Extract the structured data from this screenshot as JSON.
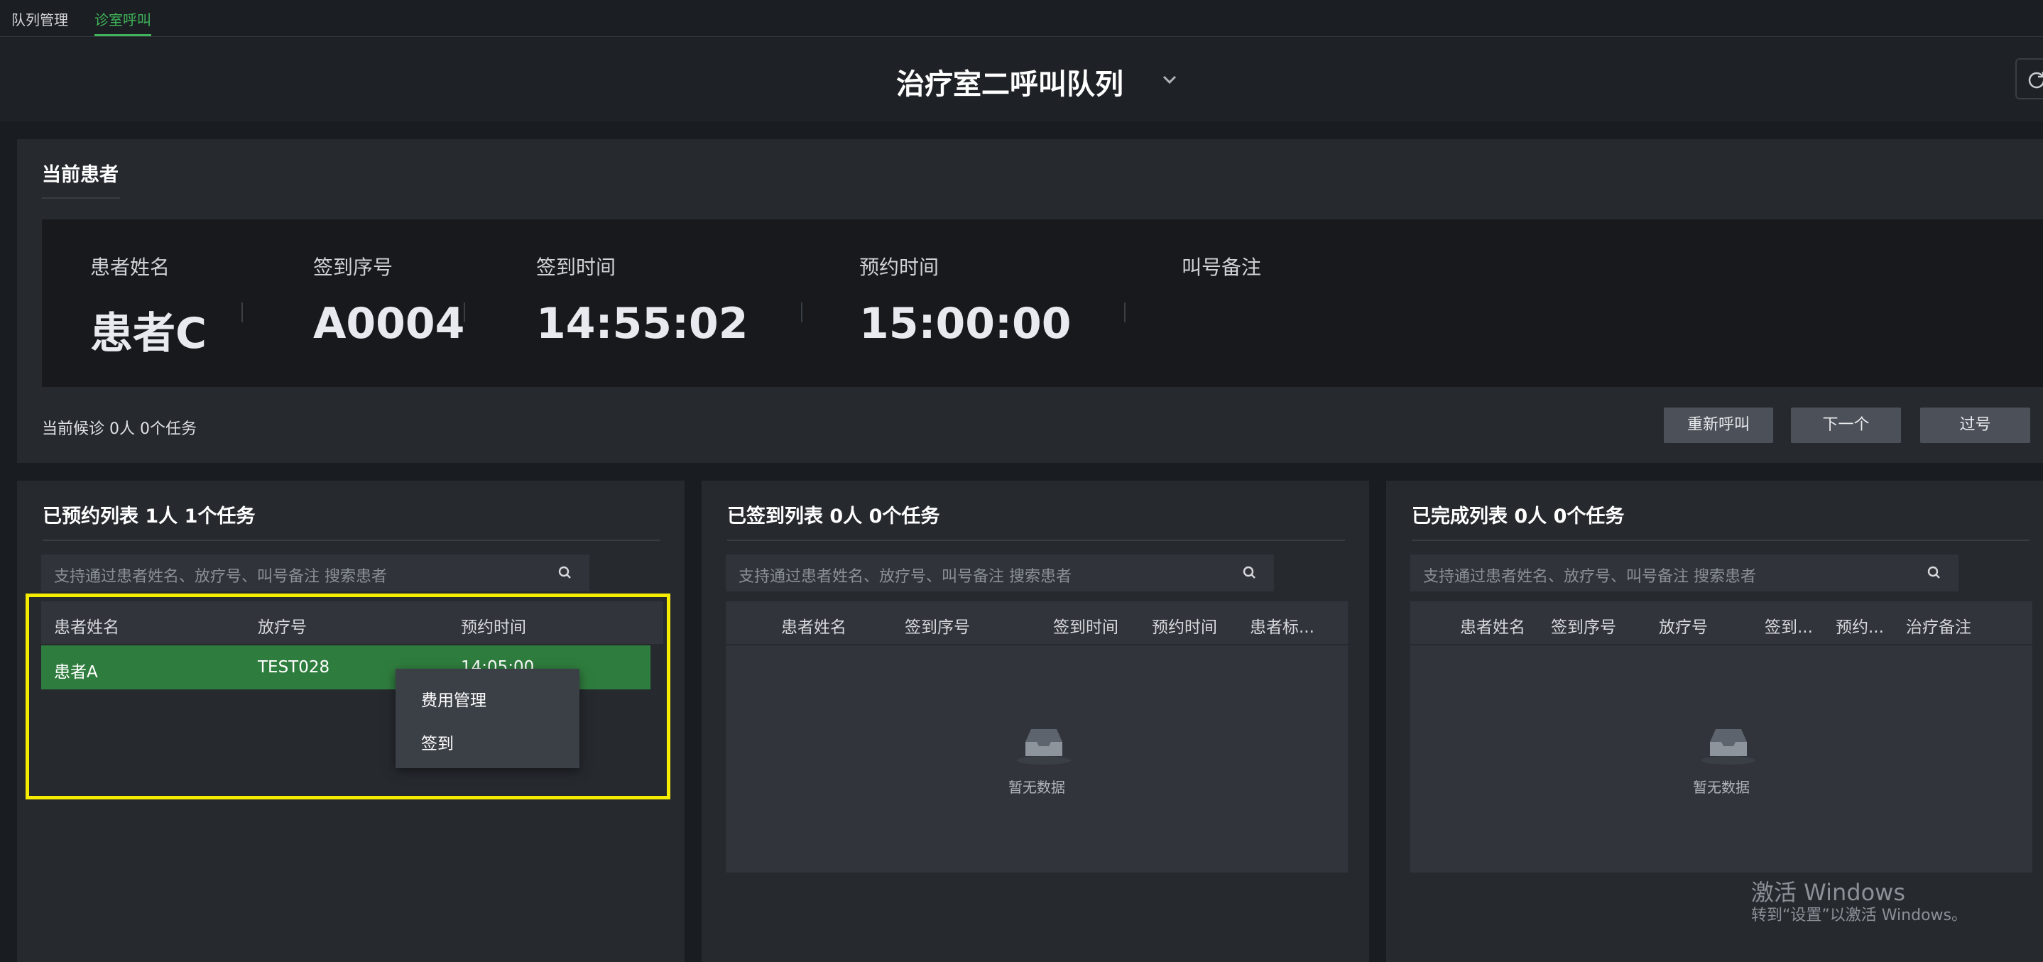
{
  "tabs": [
    {
      "label": "队列管理",
      "active": false
    },
    {
      "label": "诊室呼叫",
      "active": true
    }
  ],
  "header": {
    "title": "治疗室二呼叫队列"
  },
  "current": {
    "title": "当前患者",
    "fields": [
      {
        "label": "患者姓名",
        "value": "患者C"
      },
      {
        "label": "签到序号",
        "value": "A0004"
      },
      {
        "label": "签到时间",
        "value": "14:55:02"
      },
      {
        "label": "预约时间",
        "value": "15:00:00"
      },
      {
        "label": "叫号备注",
        "value": ""
      }
    ],
    "waiting": "当前候诊 0人 0个任务",
    "buttons": {
      "recall": "重新呼叫",
      "next": "下一个",
      "skip": "过号"
    }
  },
  "reserved": {
    "title": "已预约列表 1人 1个任务",
    "search_placeholder": "支持通过患者姓名、放疗号、叫号备注 搜索患者",
    "columns": [
      "患者姓名",
      "放疗号",
      "预约时间"
    ],
    "rows": [
      {
        "name": "患者A",
        "id": "TEST028",
        "time": "14:05:00"
      }
    ]
  },
  "context_menu": {
    "items": [
      "费用管理",
      "签到"
    ]
  },
  "signed": {
    "title": "已签到列表 0人 0个任务",
    "search_placeholder": "支持通过患者姓名、放疗号、叫号备注 搜索患者",
    "columns": [
      "患者姓名",
      "签到序号",
      "签到时间",
      "预约时间",
      "患者标..."
    ],
    "empty_text": "暂无数据"
  },
  "completed": {
    "title": "已完成列表 0人 0个任务",
    "search_placeholder": "支持通过患者姓名、放疗号、叫号备注 搜索患者",
    "columns": [
      "患者姓名",
      "签到序号",
      "放疗号",
      "签到...",
      "预约...",
      "治疗备注"
    ],
    "empty_text": "暂无数据"
  },
  "watermark": {
    "title": "激活 Windows",
    "subtitle": "转到“设置”以激活 Windows。"
  },
  "colors": {
    "accent": "#3fb45a",
    "selected_row": "#2f7d3e",
    "highlight": "#f5ec00"
  }
}
